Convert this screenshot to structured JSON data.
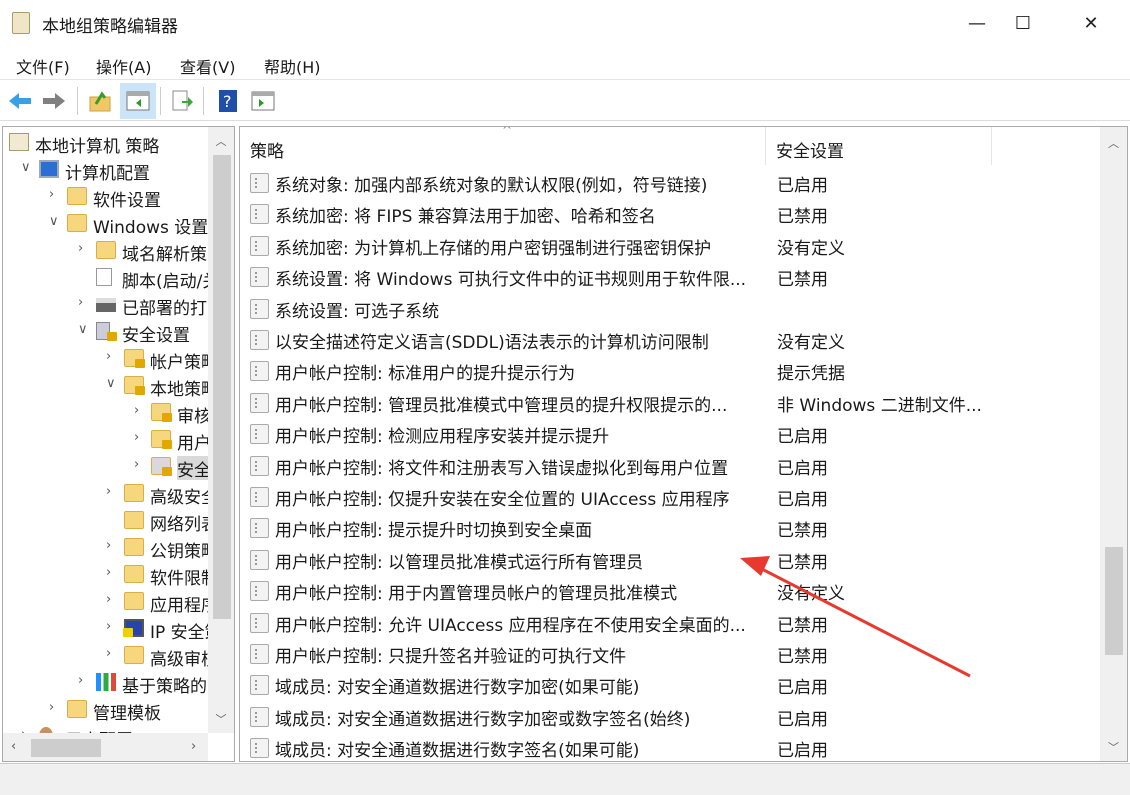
{
  "window": {
    "title": "本地组策略编辑器",
    "minimize": "—",
    "maximize": "☐",
    "close": "✕"
  },
  "menu": [
    "文件(F)",
    "操作(A)",
    "查看(V)",
    "帮助(H)"
  ],
  "toolbar": [
    "back-icon",
    "forward-icon",
    "up-folder-icon",
    "show-hide-tree-icon",
    "export-list-icon",
    "help-icon",
    "show-hide-action-pane-icon"
  ],
  "tree": [
    {
      "label": "本地计算机 策略",
      "level": 0,
      "chev": "",
      "icon": "scroll"
    },
    {
      "label": "计算机配置",
      "level": 1,
      "chev": "⌄",
      "icon": "computer"
    },
    {
      "label": "软件设置",
      "level": 2,
      "chev": "›",
      "icon": "folder"
    },
    {
      "label": "Windows 设置",
      "level": 2,
      "chev": "⌄",
      "icon": "folder"
    },
    {
      "label": "域名解析策略",
      "level": 3,
      "chev": "›",
      "icon": "folder"
    },
    {
      "label": "脚本(启动/关机)",
      "level": 3,
      "chev": "",
      "icon": "script"
    },
    {
      "label": "已部署的打印机",
      "level": 3,
      "chev": "›",
      "icon": "printer"
    },
    {
      "label": "安全设置",
      "level": 3,
      "chev": "⌄",
      "icon": "security"
    },
    {
      "label": "帐户策略",
      "level": 4,
      "chev": "›",
      "icon": "lockfolder"
    },
    {
      "label": "本地策略",
      "level": 4,
      "chev": "⌄",
      "icon": "lockfolder"
    },
    {
      "label": "审核策略",
      "level": 5,
      "chev": "›",
      "icon": "lockfolder"
    },
    {
      "label": "用户权限分配",
      "level": 5,
      "chev": "›",
      "icon": "lockfolder"
    },
    {
      "label": "安全选项",
      "level": 5,
      "chev": "›",
      "icon": "lockfolder",
      "selected": true
    },
    {
      "label": "高级安全 Windows Defender 防火墙",
      "level": 4,
      "chev": "›",
      "icon": "folder"
    },
    {
      "label": "网络列表管理器策略",
      "level": 4,
      "chev": "",
      "icon": "folder"
    },
    {
      "label": "公钥策略",
      "level": 4,
      "chev": "›",
      "icon": "folder"
    },
    {
      "label": "软件限制策略",
      "level": 4,
      "chev": "›",
      "icon": "folder"
    },
    {
      "label": "应用程序控制策略",
      "level": 4,
      "chev": "›",
      "icon": "folder"
    },
    {
      "label": "IP 安全策略",
      "level": 4,
      "chev": "›",
      "icon": "ipsec"
    },
    {
      "label": "高级审核策略配置",
      "level": 4,
      "chev": "›",
      "icon": "folder"
    },
    {
      "label": "基于策略的 QoS",
      "level": 3,
      "chev": "›",
      "icon": "chart"
    },
    {
      "label": "管理模板",
      "level": 2,
      "chev": "›",
      "icon": "folder"
    },
    {
      "label": "用户配置",
      "level": 1,
      "chev": "›",
      "icon": "user"
    }
  ],
  "list": {
    "columns": [
      "策略",
      "安全设置"
    ],
    "rows": [
      {
        "policy": "系统对象: 加强内部系统对象的默认权限(例如，符号链接)",
        "setting": "已启用"
      },
      {
        "policy": "系统加密: 将 FIPS 兼容算法用于加密、哈希和签名",
        "setting": "已禁用"
      },
      {
        "policy": "系统加密: 为计算机上存储的用户密钥强制进行强密钥保护",
        "setting": "没有定义"
      },
      {
        "policy": "系统设置: 将 Windows 可执行文件中的证书规则用于软件限...",
        "setting": "已禁用"
      },
      {
        "policy": "系统设置: 可选子系统",
        "setting": ""
      },
      {
        "policy": "以安全描述符定义语言(SDDL)语法表示的计算机访问限制",
        "setting": "没有定义"
      },
      {
        "policy": "用户帐户控制: 标准用户的提升提示行为",
        "setting": "提示凭据"
      },
      {
        "policy": "用户帐户控制: 管理员批准模式中管理员的提升权限提示的...",
        "setting": "非 Windows 二进制文件..."
      },
      {
        "policy": "用户帐户控制: 检测应用程序安装并提示提升",
        "setting": "已启用"
      },
      {
        "policy": "用户帐户控制: 将文件和注册表写入错误虚拟化到每用户位置",
        "setting": "已启用"
      },
      {
        "policy": "用户帐户控制: 仅提升安装在安全位置的 UIAccess 应用程序",
        "setting": "已启用"
      },
      {
        "policy": "用户帐户控制: 提示提升时切换到安全桌面",
        "setting": "已禁用"
      },
      {
        "policy": "用户帐户控制: 以管理员批准模式运行所有管理员",
        "setting": "已禁用"
      },
      {
        "policy": "用户帐户控制: 用于内置管理员帐户的管理员批准模式",
        "setting": "没有定义"
      },
      {
        "policy": "用户帐户控制: 允许 UIAccess 应用程序在不使用安全桌面的...",
        "setting": "已禁用"
      },
      {
        "policy": "用户帐户控制: 只提升签名并验证的可执行文件",
        "setting": "已禁用"
      },
      {
        "policy": "域成员: 对安全通道数据进行数字加密(如果可能)",
        "setting": "已启用"
      },
      {
        "policy": "域成员: 对安全通道数据进行数字加密或数字签名(始终)",
        "setting": "已启用"
      },
      {
        "policy": "域成员: 对安全通道数据进行数字签名(如果可能)",
        "setting": "已启用"
      }
    ]
  },
  "annotation": {
    "color": "#e8392f"
  }
}
